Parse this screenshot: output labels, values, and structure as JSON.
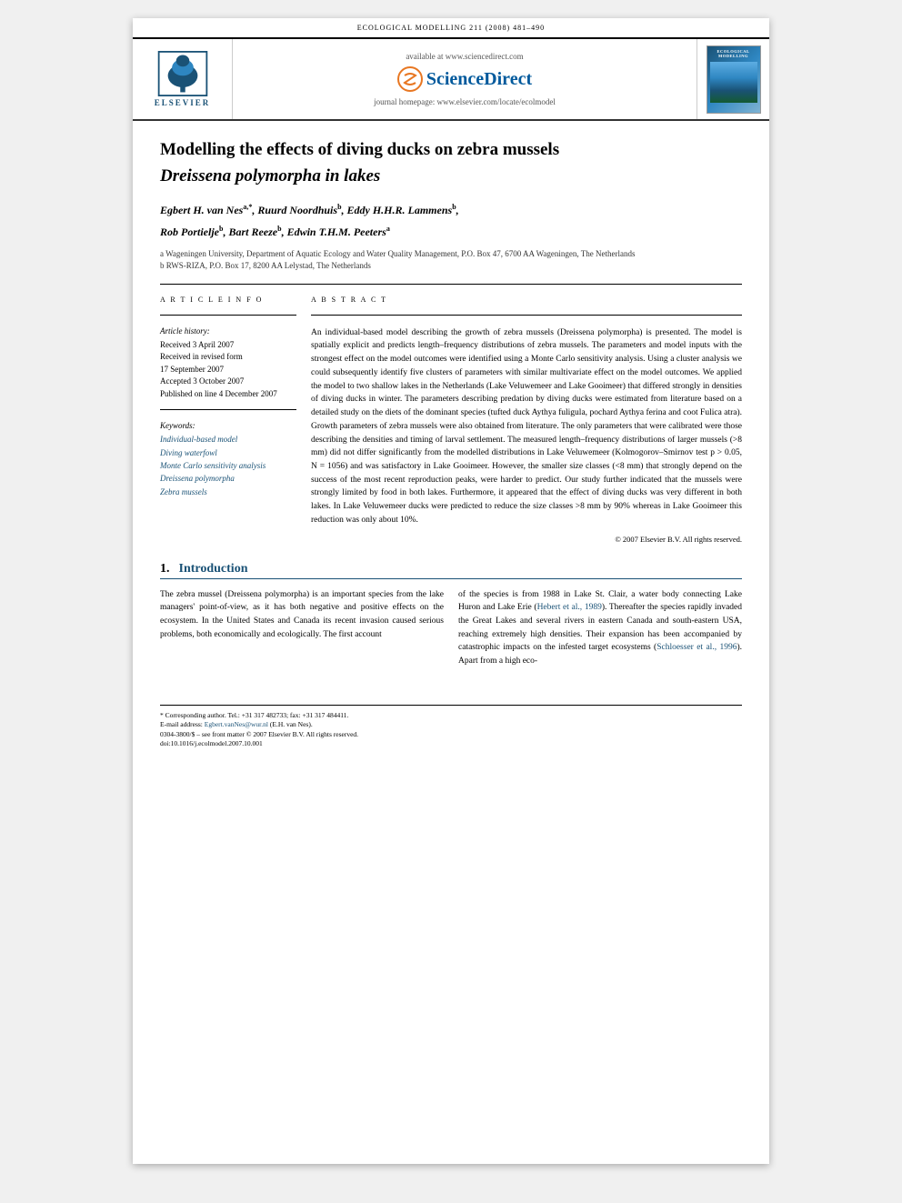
{
  "journal": {
    "name_top": "Ecological Modelling 211 (2008) 481–490",
    "available_text": "available at www.sciencedirect.com",
    "homepage_text": "journal homepage: www.elsevier.com/locate/ecolmodel",
    "sciencedirect_label": "ScienceDirect",
    "thumb_title": "ECOLOGICAL\nMODELLING"
  },
  "article": {
    "title_line1": "Modelling the effects of diving ducks on zebra mussels",
    "title_line2": "Dreissena polymorpha in lakes",
    "authors": "Egbert H. van Nes",
    "author_sup1": "a,*",
    "author2": ", Ruurd Noordhuis",
    "author_sup2": "b",
    "author3": ", Eddy H.H.R. Lammens",
    "author_sup3": "b",
    "author4": ",",
    "author5": "Rob Portielje",
    "author_sup5": "b",
    "author6": ", Bart Reeze",
    "author_sup6": "b",
    "author7": ", Edwin T.H.M. Peeters",
    "author_sup7": "a",
    "affil_a": "a Wageningen University, Department of Aquatic Ecology and Water Quality Management, P.O. Box 47, 6700 AA Wageningen, The Netherlands",
    "affil_b": "b RWS-RIZA, P.O. Box 17, 8200 AA Lelystad, The Netherlands"
  },
  "article_info": {
    "section_label": "A R T I C L E   I N F O",
    "history_label": "Article history:",
    "received": "Received 3 April 2007",
    "revised": "Received in revised form",
    "revised_date": "17 September 2007",
    "accepted": "Accepted 3 October 2007",
    "published": "Published on line 4 December 2007",
    "keywords_label": "Keywords:",
    "keyword1": "Individual-based model",
    "keyword2": "Diving waterfowl",
    "keyword3": "Monte Carlo sensitivity analysis",
    "keyword4": "Dreissena polymorpha",
    "keyword5": "Zebra mussels"
  },
  "abstract": {
    "section_label": "A B S T R A C T",
    "text": "An individual-based model describing the growth of zebra mussels (Dreissena polymorpha) is presented. The model is spatially explicit and predicts length–frequency distributions of zebra mussels. The parameters and model inputs with the strongest effect on the model outcomes were identified using a Monte Carlo sensitivity analysis. Using a cluster analysis we could subsequently identify five clusters of parameters with similar multivariate effect on the model outcomes. We applied the model to two shallow lakes in the Netherlands (Lake Veluwemeer and Lake Gooimeer) that differed strongly in densities of diving ducks in winter. The parameters describing predation by diving ducks were estimated from literature based on a detailed study on the diets of the dominant species (tufted duck Aythya fuligula, pochard Aythya ferina and coot Fulica atra). Growth parameters of zebra mussels were also obtained from literature. The only parameters that were calibrated were those describing the densities and timing of larval settlement. The measured length–frequency distributions of larger mussels (>8 mm) did not differ significantly from the modelled distributions in Lake Veluwemeer (Kolmogorov–Smirnov test p > 0.05, N = 1056) and was satisfactory in Lake Gooimeer. However, the smaller size classes (<8 mm) that strongly depend on the success of the most recent reproduction peaks, were harder to predict. Our study further indicated that the mussels were strongly limited by food in both lakes. Furthermore, it appeared that the effect of diving ducks was very different in both lakes. In Lake Veluwemeer ducks were predicted to reduce the size classes >8 mm by 90% whereas in Lake Gooimeer this reduction was only about 10%.",
    "copyright": "© 2007 Elsevier B.V. All rights reserved."
  },
  "introduction": {
    "number": "1.",
    "title": "Introduction",
    "para1": "The zebra mussel (Dreissena polymorpha) is an important species from the lake managers' point-of-view, as it has both negative and positive effects on the ecosystem. In the United States and Canada its recent invasion caused serious problems, both economically and ecologically. The first account",
    "para2": "of the species is from 1988 in Lake St. Clair, a water body connecting Lake Huron and Lake Erie (Hebert et al., 1989). Thereafter the species rapidly invaded the Great Lakes and several rivers in eastern Canada and south-eastern USA, reaching extremely high densities. Their expansion has been accompanied by catastrophic impacts on the infested target ecosystems (Schloesser et al., 1996). Apart from a high eco-"
  },
  "footer": {
    "corresponding_note": "* Corresponding author. Tel.: +31 317 482733; fax: +31 317 484411.",
    "email_label": "E-mail address: ",
    "email": "Egbert.vanNes@wur.nl",
    "email_suffix": " (E.H. van Nes).",
    "license": "0304-3800/$ – see front matter © 2007 Elsevier B.V. All rights reserved.",
    "doi": "doi:10.1016/j.ecolmodel.2007.10.001"
  }
}
